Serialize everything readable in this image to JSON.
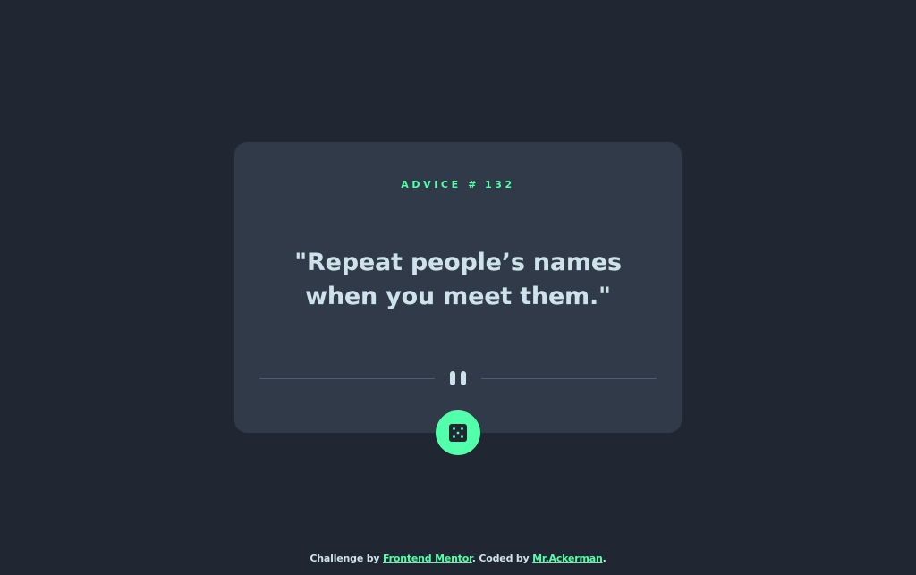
{
  "card": {
    "advice_prefix": "ADVICE #",
    "advice_number": "132",
    "quote": "\"Repeat people’s names when you meet them.\""
  },
  "dice_button": {
    "icon": "dice-icon",
    "accent": "#53ffaa"
  },
  "footer": {
    "prefix": "Challenge by",
    "challenge_link": "Frontend Mentor",
    "middle": ". Coded by",
    "author_link": "Mr.Ackerman",
    "suffix": "."
  },
  "colors": {
    "background": "#202632",
    "card": "#313a48",
    "accent": "#53ffaa",
    "text": "#cee3e9",
    "divider": "#4f5d74"
  }
}
